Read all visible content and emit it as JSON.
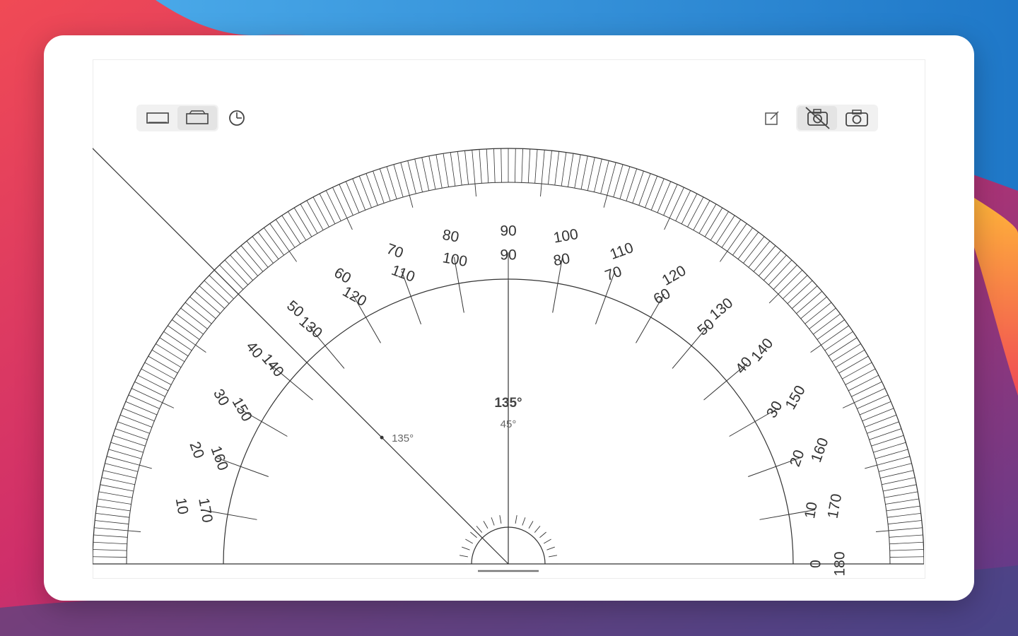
{
  "app": {
    "reading": {
      "primary": "135°",
      "secondary": "45°",
      "pointer_label": "135°",
      "angle_deg": 135
    },
    "scale": {
      "outer_labels": [
        "10",
        "20",
        "30",
        "40",
        "50",
        "60",
        "70",
        "80",
        "90",
        "100",
        "110",
        "120",
        "130",
        "140",
        "150",
        "160",
        "170",
        "180"
      ],
      "inner_labels": [
        "170",
        "160",
        "150",
        "140",
        "130",
        "120",
        "110",
        "100",
        "90",
        "80",
        "70",
        "60",
        "50",
        "40",
        "30",
        "20",
        "10",
        "0"
      ]
    },
    "toolbar_left": {
      "items": [
        {
          "icon": "rectangle-icon",
          "active": true
        },
        {
          "icon": "frame-icon",
          "active": false
        },
        {
          "icon": "theta-icon",
          "active": false
        }
      ]
    },
    "toolbar_right": {
      "items": [
        {
          "icon": "edit-icon"
        },
        {
          "icon": "camera-off-icon"
        },
        {
          "icon": "camera-icon"
        }
      ]
    },
    "colors": {
      "ink": "#333333",
      "background": "#ffffff"
    }
  }
}
